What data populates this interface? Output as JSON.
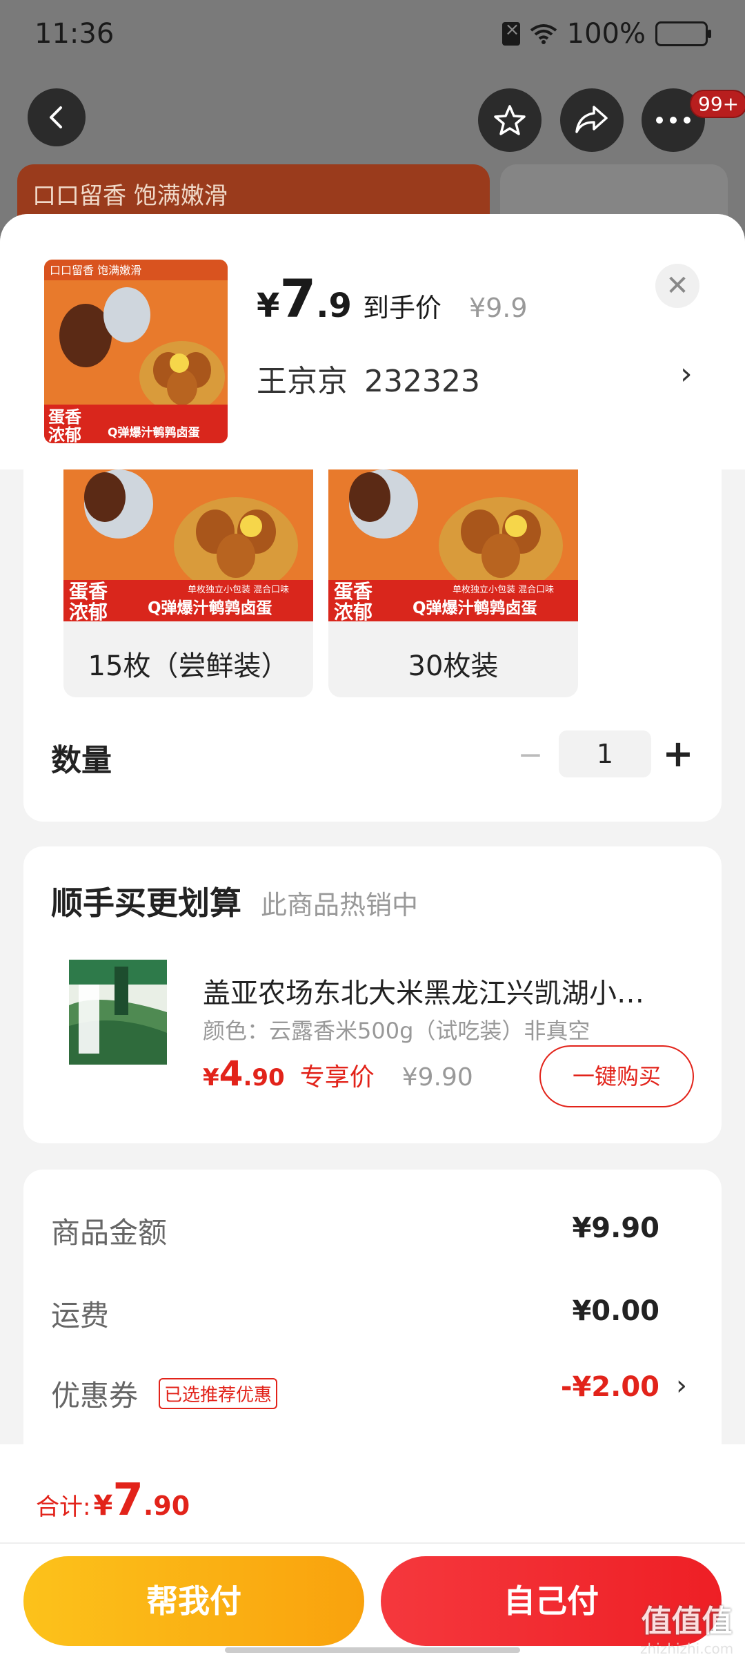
{
  "status": {
    "time": "11:36",
    "battery": "100%"
  },
  "header": {
    "badge": "99+"
  },
  "banner": {
    "text": "口口留香 饱满嫩滑"
  },
  "product": {
    "price_symbol": "¥",
    "price_int": "7",
    "price_dec": ".9",
    "price_tag": "到手价",
    "original_price": "¥9.9",
    "buyer_name": "王京京",
    "buyer_id": "232323"
  },
  "options": [
    {
      "label": "15枚（尝鲜装）"
    },
    {
      "label": "30枚装"
    }
  ],
  "option_image_text": {
    "line1": "蛋香",
    "line2": "浓郁",
    "slogan": "Q弹爆汁鹌鹑卤蛋",
    "small": "单枚独立小包装 混合口味",
    "top": "口口留香 饱满嫩滑"
  },
  "quantity": {
    "label": "数量",
    "value": "1",
    "minus": "−",
    "plus": "+"
  },
  "addon": {
    "title": "顺手买更划算",
    "subtitle": "此商品热销中",
    "name": "盖亚农场东北大米黑龙江兴凯湖小…",
    "spec": "颜色：云露香米500g（试吃装）非真空",
    "price_symbol": "¥",
    "price_int": "4",
    "price_dec": ".90",
    "price_tag": "专享价",
    "original_price": "¥9.90",
    "buy_label": "一键购买"
  },
  "summary": {
    "goods_label": "商品金额",
    "goods_value": "¥9.90",
    "shipping_label": "运费",
    "shipping_value": "¥0.00",
    "coupon_label": "优惠券",
    "coupon_tag": "已选推荐优惠",
    "coupon_value": "-¥2.00"
  },
  "footer": {
    "total_label": "合计:",
    "total_symbol": "¥",
    "total_int": "7",
    "total_dec": ".90",
    "help_pay": "帮我付",
    "self_pay": "自己付"
  },
  "watermark": {
    "big": "值值值",
    "small": "zhizhizhi.com"
  },
  "colors": {
    "accent_red": "#e2231a",
    "yellow_btn": "#fcc21b",
    "red_btn": "#f5383d"
  }
}
